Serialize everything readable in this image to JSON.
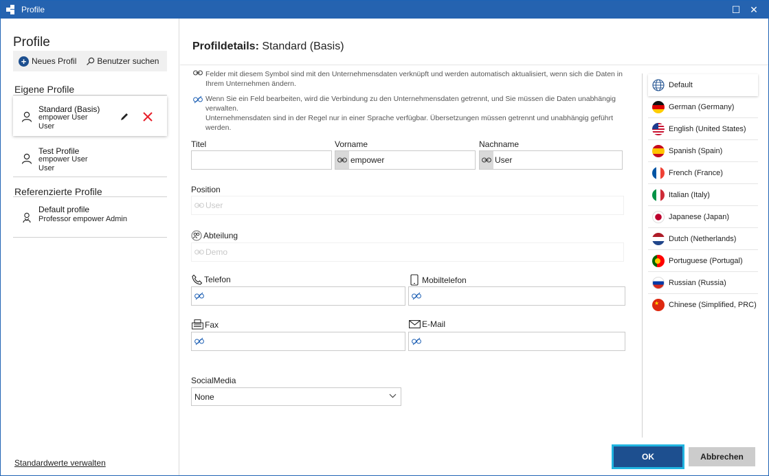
{
  "window": {
    "title": "Profile",
    "maximize_glyph": "☐",
    "close_glyph": "✕"
  },
  "left": {
    "heading": "Profile",
    "toolbar": {
      "new_profile": "Neues Profil",
      "search_users": "Benutzer suchen"
    },
    "own_profiles_heading": "Eigene Profile",
    "own_profiles": [
      {
        "name": "Standard (Basis)",
        "line1": "empower User",
        "line2": "User",
        "selected": true
      },
      {
        "name": "Test Profile",
        "line1": "empower User",
        "line2": "User",
        "selected": false
      }
    ],
    "referenced_heading": "Referenzierte Profile",
    "referenced_profiles": [
      {
        "name": "Default profile",
        "line1": "Professor empower Admin"
      }
    ],
    "manage_defaults_link": "Standardwerte verwalten"
  },
  "main": {
    "title_bold": "Profildetails:",
    "title_rest": "Standard (Basis)",
    "info_linked": "Felder mit diesem Symbol sind mit den Unternehmensdaten verknüpft und werden automatisch aktualisiert, wenn sich die Daten in Ihrem Unternehmen ändern.",
    "info_unlinked_1": "Wenn Sie ein Feld bearbeiten, wird die Verbindung zu den Unternehmensdaten getrennt, und Sie müssen die Daten unabhängig verwalten.",
    "info_unlinked_2": "Unternehmensdaten sind in der Regel nur in einer Sprache verfügbar. Übersetzungen müssen getrennt und unabhängig geführt werden.",
    "fields": {
      "titel": {
        "label": "Titel",
        "value": ""
      },
      "vorname": {
        "label": "Vorname",
        "value": "empower"
      },
      "nachname": {
        "label": "Nachname",
        "value": "User"
      },
      "position": {
        "label": "Position",
        "value": "User"
      },
      "abteilung": {
        "label": "Abteilung",
        "value": "Demo"
      },
      "telefon": {
        "label": "Telefon",
        "value": ""
      },
      "mobiltelefon": {
        "label": "Mobiltelefon",
        "value": ""
      },
      "fax": {
        "label": "Fax",
        "value": ""
      },
      "email": {
        "label": "E-Mail",
        "value": ""
      },
      "socialmedia": {
        "label": "SocialMedia",
        "value": "None"
      }
    },
    "languages": [
      {
        "label": "Default",
        "icon": "globe-icon",
        "selected": true
      },
      {
        "label": "German (Germany)",
        "icon": "flag-germany-icon"
      },
      {
        "label": "English (United States)",
        "icon": "flag-usa-icon"
      },
      {
        "label": "Spanish (Spain)",
        "icon": "flag-spain-icon"
      },
      {
        "label": "French (France)",
        "icon": "flag-france-icon"
      },
      {
        "label": "Italian (Italy)",
        "icon": "flag-italy-icon"
      },
      {
        "label": "Japanese (Japan)",
        "icon": "flag-japan-icon"
      },
      {
        "label": "Dutch (Netherlands)",
        "icon": "flag-netherlands-icon"
      },
      {
        "label": "Portuguese (Portugal)",
        "icon": "flag-portugal-icon"
      },
      {
        "label": "Russian (Russia)",
        "icon": "flag-russia-icon"
      },
      {
        "label": "Chinese (Simplified, PRC)",
        "icon": "flag-china-icon"
      }
    ],
    "buttons": {
      "ok": "OK",
      "cancel": "Abbrechen"
    }
  },
  "colors": {
    "titlebar": "#2563b0",
    "primary": "#1d4f8f",
    "focus": "#20b4e0",
    "delete": "#e8202a"
  }
}
